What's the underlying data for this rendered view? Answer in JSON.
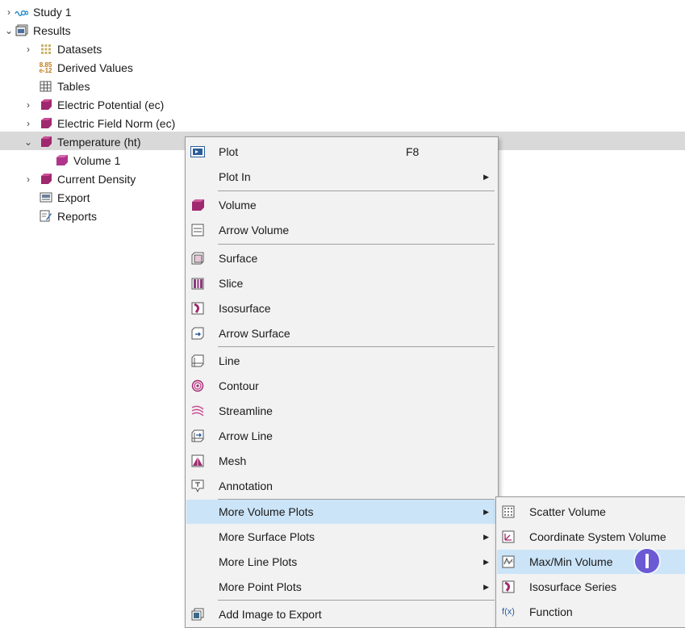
{
  "tree": {
    "study": "Study 1",
    "results": "Results",
    "datasets": "Datasets",
    "derived_values": "Derived Values",
    "derived_icon_text": "8.85\ne-12",
    "tables": "Tables",
    "electric_potential": "Electric Potential (ec)",
    "electric_field_norm": "Electric Field Norm (ec)",
    "temperature": "Temperature (ht)",
    "volume1": "Volume 1",
    "current_density": "Current Density",
    "export": "Export",
    "reports": "Reports"
  },
  "context_menu": {
    "plot": "Plot",
    "plot_shortcut": "F8",
    "plot_in": "Plot In",
    "volume": "Volume",
    "arrow_volume": "Arrow Volume",
    "surface": "Surface",
    "slice": "Slice",
    "isosurface": "Isosurface",
    "arrow_surface": "Arrow Surface",
    "line": "Line",
    "contour": "Contour",
    "streamline": "Streamline",
    "arrow_line": "Arrow Line",
    "mesh": "Mesh",
    "annotation": "Annotation",
    "more_volume_plots": "More Volume Plots",
    "more_surface_plots": "More Surface Plots",
    "more_line_plots": "More Line Plots",
    "more_point_plots": "More Point Plots",
    "add_image_to_export": "Add Image to Export"
  },
  "submenu": {
    "scatter_volume": "Scatter Volume",
    "coordinate_system_volume": "Coordinate System Volume",
    "maxmin_volume": "Max/Min Volume",
    "isosurface_series": "Isosurface Series",
    "function": "Function",
    "function_icon_text": "f(x)"
  },
  "colors": {
    "plot_group_magenta": "#a0286f",
    "highlight": "#cce4f7",
    "selected_row": "#d9d9d9",
    "cursor": "#6a5ad4"
  }
}
